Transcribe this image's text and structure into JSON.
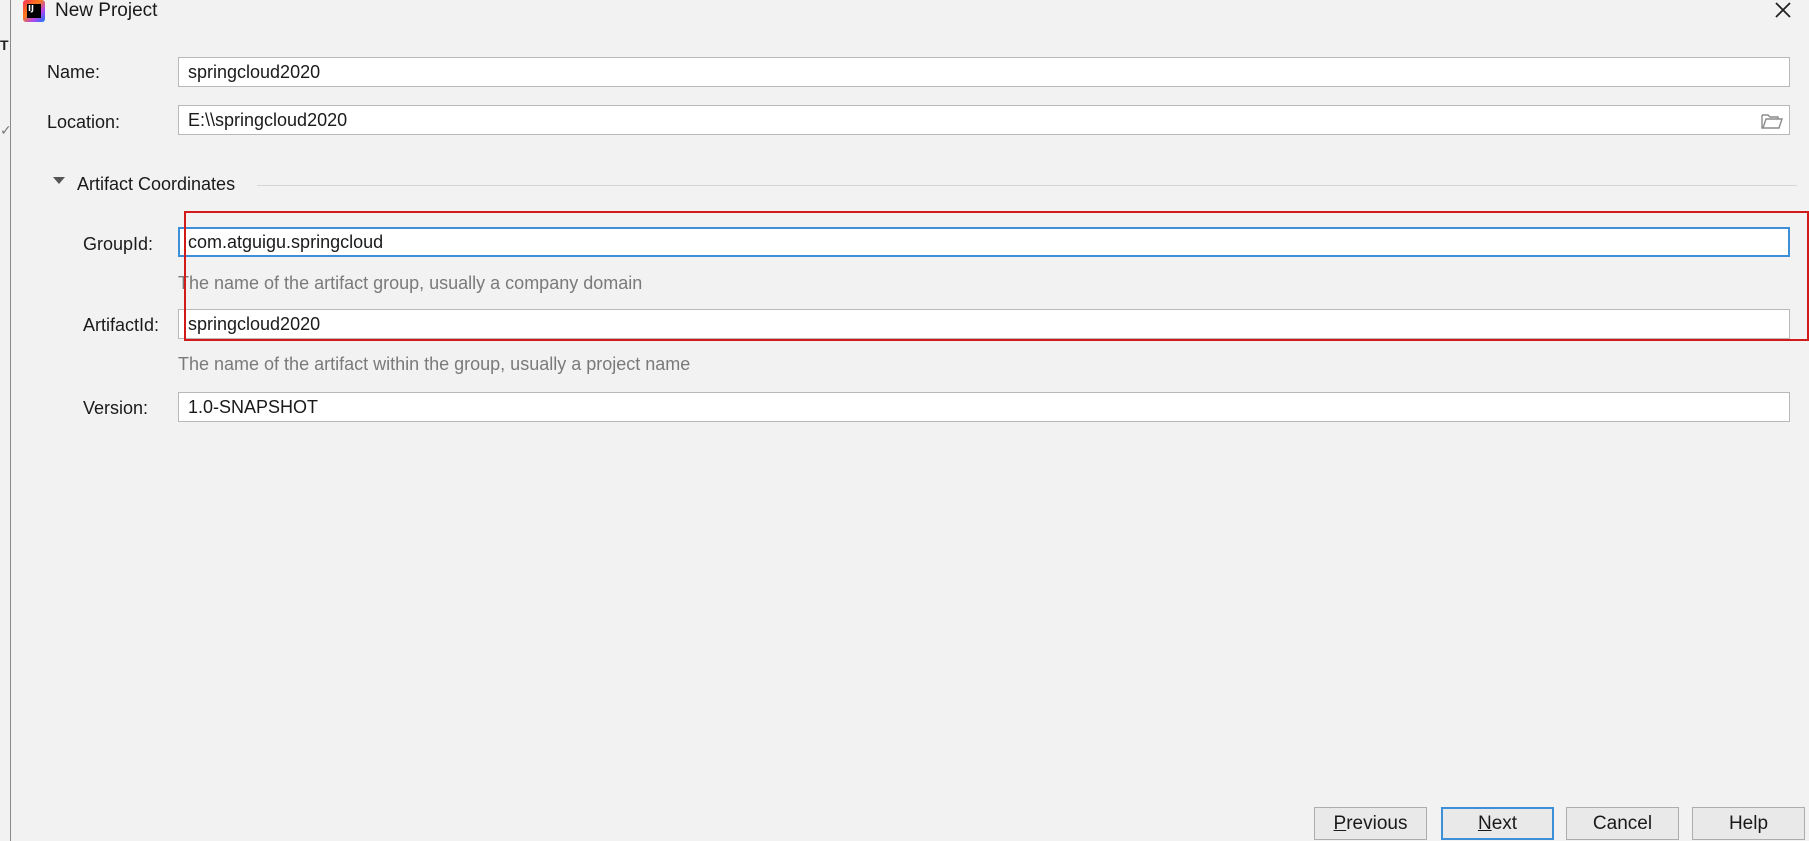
{
  "window": {
    "title": "New Project",
    "app_icon_text": "IJ"
  },
  "edge_glyphs": [
    "T",
    "✓"
  ],
  "form": {
    "name_label": "Name:",
    "name_value": "springcloud2020",
    "location_label": "Location:",
    "location_value": "E:\\\\springcloud2020",
    "section_title": "Artifact Coordinates",
    "groupid_label": "GroupId:",
    "groupid_value": "com.atguigu.springcloud",
    "groupid_hint": "The name of the artifact group, usually a company domain",
    "artifactid_label": "ArtifactId:",
    "artifactid_value": "springcloud2020",
    "artifactid_hint": "The name of the artifact within the group, usually a project name",
    "version_label": "Version:",
    "version_value": "1.0-SNAPSHOT"
  },
  "buttons": {
    "previous": {
      "mnemonic": "P",
      "rest": "revious"
    },
    "next": {
      "mnemonic": "N",
      "rest": "ext"
    },
    "cancel": "Cancel",
    "help": "Help"
  },
  "colors": {
    "focus_border": "#3d8fd8",
    "annotation": "#d11a1a",
    "hint_text": "#7a7a7a"
  },
  "icons": [
    "close-icon",
    "folder-icon",
    "expand-triangle-icon",
    "intellij-app-icon"
  ]
}
